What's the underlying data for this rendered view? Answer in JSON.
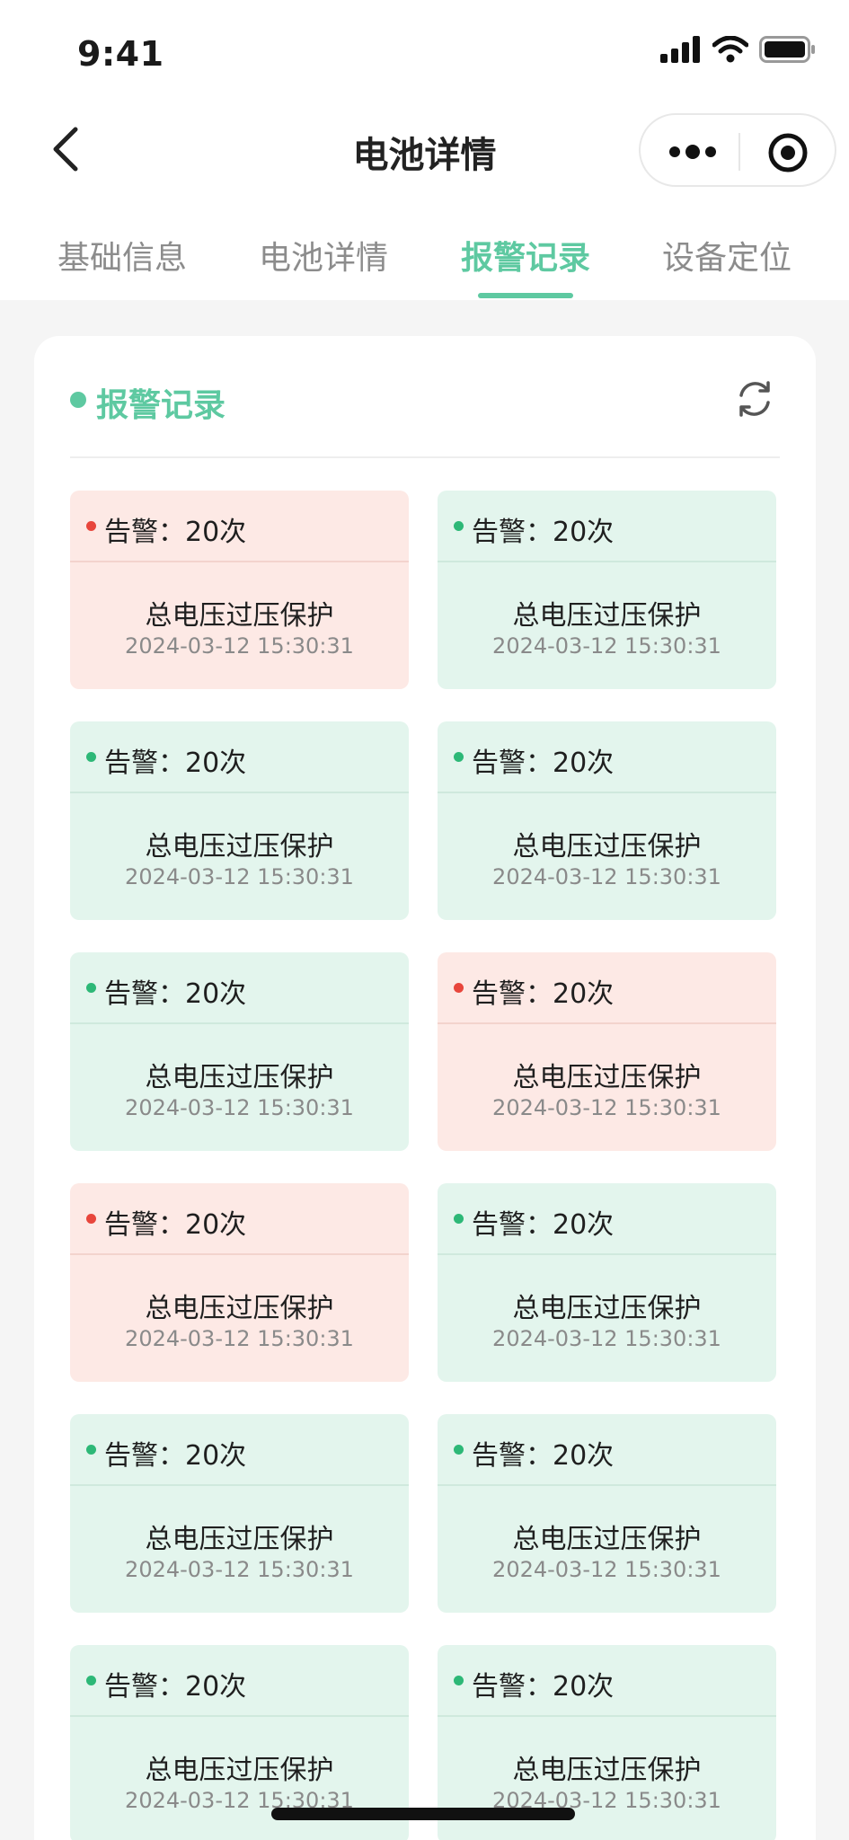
{
  "status": {
    "time": "9:41"
  },
  "nav": {
    "title": "电池详情"
  },
  "tabs": [
    {
      "label": "基础信息",
      "active": false
    },
    {
      "label": "电池详情",
      "active": false
    },
    {
      "label": "报警记录",
      "active": true
    },
    {
      "label": "设备定位",
      "active": false
    }
  ],
  "section": {
    "title": "报警记录"
  },
  "colors": {
    "accent": "#5ec9a1",
    "alarm_red": "#e8463c",
    "alarm_green": "#2db877"
  },
  "alarms": [
    {
      "count": "告警：20次",
      "name": "总电压过压保护",
      "time": "2024-03-12 15:30:31",
      "status": "red"
    },
    {
      "count": "告警：20次",
      "name": "总电压过压保护",
      "time": "2024-03-12 15:30:31",
      "status": "green"
    },
    {
      "count": "告警：20次",
      "name": "总电压过压保护",
      "time": "2024-03-12 15:30:31",
      "status": "green"
    },
    {
      "count": "告警：20次",
      "name": "总电压过压保护",
      "time": "2024-03-12 15:30:31",
      "status": "green"
    },
    {
      "count": "告警：20次",
      "name": "总电压过压保护",
      "time": "2024-03-12 15:30:31",
      "status": "green"
    },
    {
      "count": "告警：20次",
      "name": "总电压过压保护",
      "time": "2024-03-12 15:30:31",
      "status": "red"
    },
    {
      "count": "告警：20次",
      "name": "总电压过压保护",
      "time": "2024-03-12 15:30:31",
      "status": "red"
    },
    {
      "count": "告警：20次",
      "name": "总电压过压保护",
      "time": "2024-03-12 15:30:31",
      "status": "green"
    },
    {
      "count": "告警：20次",
      "name": "总电压过压保护",
      "time": "2024-03-12 15:30:31",
      "status": "green"
    },
    {
      "count": "告警：20次",
      "name": "总电压过压保护",
      "time": "2024-03-12 15:30:31",
      "status": "green"
    },
    {
      "count": "告警：20次",
      "name": "总电压过压保护",
      "time": "2024-03-12 15:30:31",
      "status": "green"
    },
    {
      "count": "告警：20次",
      "name": "总电压过压保护",
      "time": "2024-03-12 15:30:31",
      "status": "green"
    }
  ]
}
